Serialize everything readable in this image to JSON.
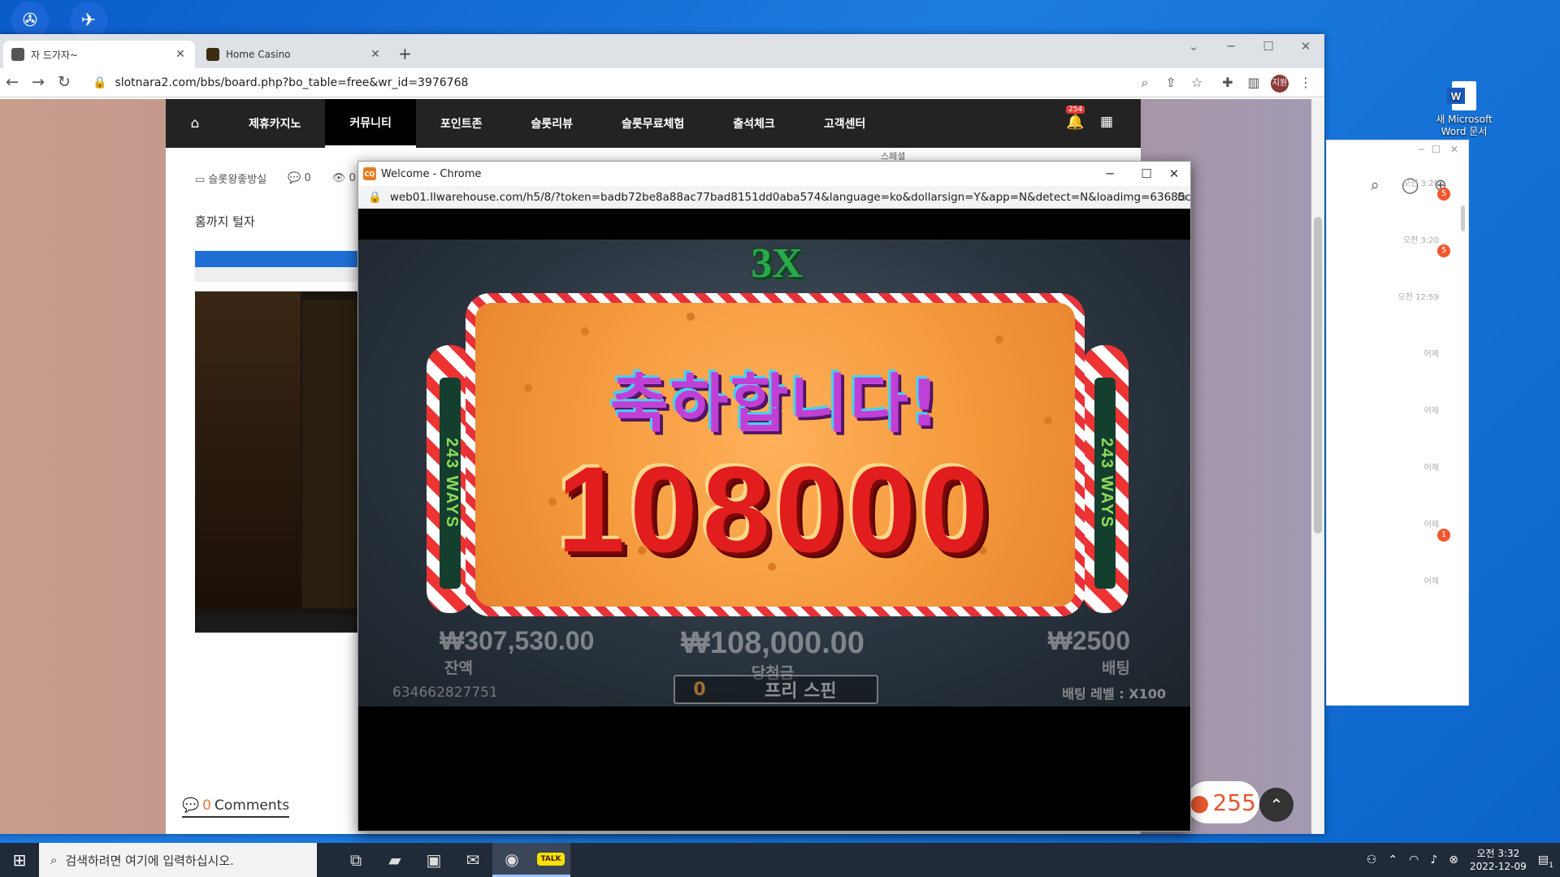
{
  "desktop": {
    "icons": [
      {
        "name": "app-icon",
        "glyph": "✇"
      },
      {
        "name": "telegram-icon",
        "glyph": "✈"
      }
    ],
    "word_file": {
      "line1": "새 Microsoft",
      "line2": "Word 문서",
      "badge": "W"
    }
  },
  "browser": {
    "tabs": [
      {
        "title": "자 드가자~",
        "active": true
      },
      {
        "title": "Home Casino",
        "active": false
      }
    ],
    "url": "slotnara2.com/bbs/board.php?bo_table=free&wr_id=3976768",
    "profile_initial": "지원"
  },
  "site": {
    "menu": [
      "제휴카지노",
      "커뮤니티",
      "포인트존",
      "슬롯리뷰",
      "슬롯무료체험",
      "출석체크",
      "고객센터"
    ],
    "active_menu": "커뮤니티",
    "notification_count": "254",
    "author_tag": "스페셜",
    "post": {
      "category": "슬롯왕좋방실",
      "comment_count": "0",
      "views": "0",
      "body": "홈까지 털자"
    },
    "comments_label": "Comments",
    "comments_count": "0",
    "coin_count": "255"
  },
  "popup": {
    "title": "Welcome - Chrome",
    "favicon_text": "CQ",
    "url": "web01.llwarehouse.com/h5/8/?token=badb72be8a88ac77bad8151dd0aba574&language=ko&dollarsign=Y&app=N&detect=N&loadimg=63685c0c..."
  },
  "game": {
    "multiplier": "3X",
    "ways_left": "243 WAYS",
    "ways_right": "243 WAYS",
    "congrats": "축하합니다!",
    "win_amount": "108000",
    "balance": "₩307,530.00",
    "balance_label": "잔액",
    "won": "₩108,000.00",
    "won_label": "당첨금",
    "bet": "₩2500",
    "bet_label": "배팅",
    "free_spins_count": "0",
    "free_spins_label": "프리 스핀",
    "round_id": "634662827751",
    "bet_level": "배팅 레벨 : X100"
  },
  "kakao": {
    "entries": [
      {
        "time": "오전 3:20",
        "badge": "5"
      },
      {
        "time": "오전 3:20",
        "badge": "5"
      },
      {
        "time": "오전 12:59",
        "badge": ""
      },
      {
        "time": "어제",
        "badge": ""
      },
      {
        "time": "어제",
        "badge": ""
      },
      {
        "time": "어제",
        "badge": ""
      },
      {
        "time": "어제",
        "badge": "1"
      },
      {
        "time": "어제",
        "badge": ""
      }
    ]
  },
  "taskbar": {
    "search_placeholder": "검색하려면 여기에 입력하십시오.",
    "time": "오전 3:32",
    "date": "2022-12-09",
    "notification_count": "1"
  },
  "colors": {
    "accent_red": "#e21d1d",
    "congrats_purple": "#c03fd6",
    "kakao_badge": "#f2562f"
  }
}
